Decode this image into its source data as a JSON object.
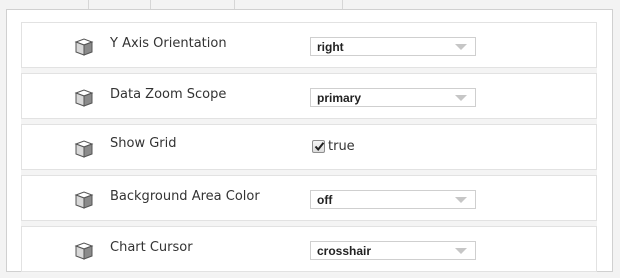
{
  "properties": [
    {
      "label": "Y Axis Orientation",
      "value": "right",
      "control": "select"
    },
    {
      "label": "Data Zoom Scope",
      "value": "primary",
      "control": "select"
    },
    {
      "label": "Show Grid",
      "value": "true",
      "control": "checkbox",
      "checked": true
    },
    {
      "label": "Background Area Color",
      "value": "off",
      "control": "select"
    },
    {
      "label": "Chart Cursor",
      "value": "crosshair",
      "control": "select"
    }
  ],
  "icons": {
    "property": "cube-icon",
    "dropdown": "chevron-down-icon",
    "check": "checkmark-icon"
  },
  "colors": {
    "panel_background": "#ffffff",
    "row_border": "#e2e2e2",
    "select_border": "#cfcfcf",
    "arrow": "#c6c6c6"
  }
}
